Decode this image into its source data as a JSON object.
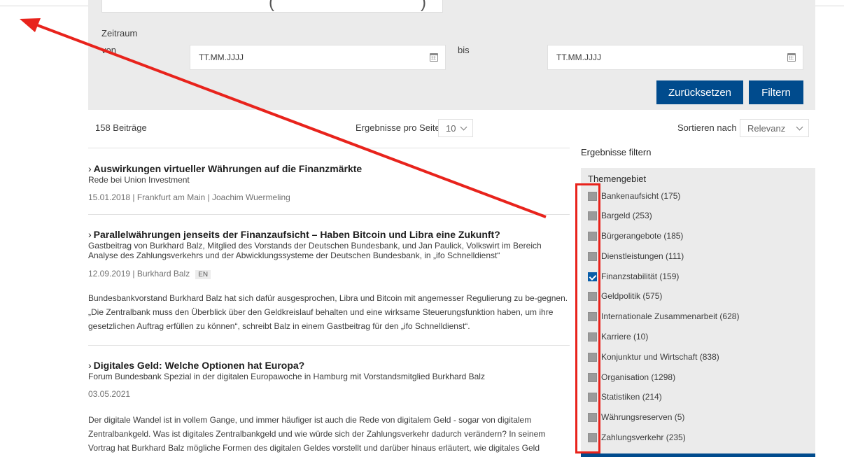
{
  "filters": {
    "date_range_label": "Zeitraum",
    "from_label": "von",
    "to_label": "bis",
    "from_placeholder": "TT.MM.JJJJ",
    "to_placeholder": "TT.MM.JJJJ",
    "reset_label": "Zurücksetzen",
    "filter_label": "Filtern"
  },
  "results": {
    "count_text": "158 Beiträge",
    "per_page_label": "Ergebnisse pro Seite",
    "per_page_value": "10",
    "sort_label": "Sortieren nach",
    "sort_value": "Relevanz"
  },
  "articles": [
    {
      "title": "Auswirkungen virtueller Währungen auf die Finanzmärkte",
      "subtitle": "Rede bei Union Investment",
      "meta": "15.01.2018 | Frankfurt am Main | Joachim Wuermeling"
    },
    {
      "title": "Parallelwährungen jenseits der Finanzaufsicht – Haben Bitcoin und Libra eine Zukunft?",
      "subtitle": "Gastbeitrag von Burkhard Balz, Mitglied des Vorstands der Deutschen Bundesbank, und Jan Paulick, Volkswirt im Bereich Analyse des Zahlungsverkehrs und der Abwicklungssysteme der Deutschen Bundesbank, in „ifo Schnelldienst“",
      "meta": "12.09.2019 | Burkhard Balz",
      "badge": "EN",
      "text": "Bundesbankvorstand Burkhard Balz hat sich dafür ausgesprochen, Libra und Bitcoin mit angemesser Regulierung zu be-gegnen. „Die Zentralbank muss den Überblick über den Geldkreislauf behalten und eine wirksame Steuerungsfunktion haben, um ihre gesetzlichen Auftrag erfüllen zu können“, schreibt Balz in einem Gastbeitrag für den „ifo Schnelldienst“."
    },
    {
      "title": "Digitales Geld: Welche Optionen hat Europa?",
      "subtitle": "Forum Bundesbank Spezial in der digitalen Europawoche in Hamburg mit Vorstandsmitglied Burkhard Balz",
      "meta": "03.05.2021",
      "text": "Der digitale Wandel ist in vollem Gange, und immer häufiger ist auch die Rede von digitalem Geld - sogar von digitalem Zentralbankgeld. Was ist digitales Zentralbankgeld und wie würde sich der Zahlungsverkehr dadurch verändern? In seinem Vortrag hat Burkhard Balz mögliche Formen des digitalen Geldes vorstellt und darüber hinaus erläutert, wie digitales Geld"
    }
  ],
  "facets": {
    "heading": "Ergebnisse filtern",
    "group_title": "Themengebiet",
    "items": [
      {
        "label": "Bankenaufsicht (175)",
        "checked": false
      },
      {
        "label": "Bargeld (253)",
        "checked": false
      },
      {
        "label": "Bürgerangebote (185)",
        "checked": false
      },
      {
        "label": "Dienstleistungen (111)",
        "checked": false
      },
      {
        "label": "Finanzstabilität (159)",
        "checked": true
      },
      {
        "label": "Geldpolitik (575)",
        "checked": false
      },
      {
        "label": "Internationale Zusammenarbeit (628)",
        "checked": false
      },
      {
        "label": "Karriere (10)",
        "checked": false
      },
      {
        "label": "Konjunktur und Wirtschaft (838)",
        "checked": false
      },
      {
        "label": "Organisation (1298)",
        "checked": false
      },
      {
        "label": "Statistiken (214)",
        "checked": false
      },
      {
        "label": "Währungsreserven (5)",
        "checked": false
      },
      {
        "label": "Zahlungsverkehr (235)",
        "checked": false
      }
    ]
  },
  "colors": {
    "primary_button": "#004b8d",
    "annotation_red": "#e8231c",
    "panel_bg": "#ebebeb"
  }
}
